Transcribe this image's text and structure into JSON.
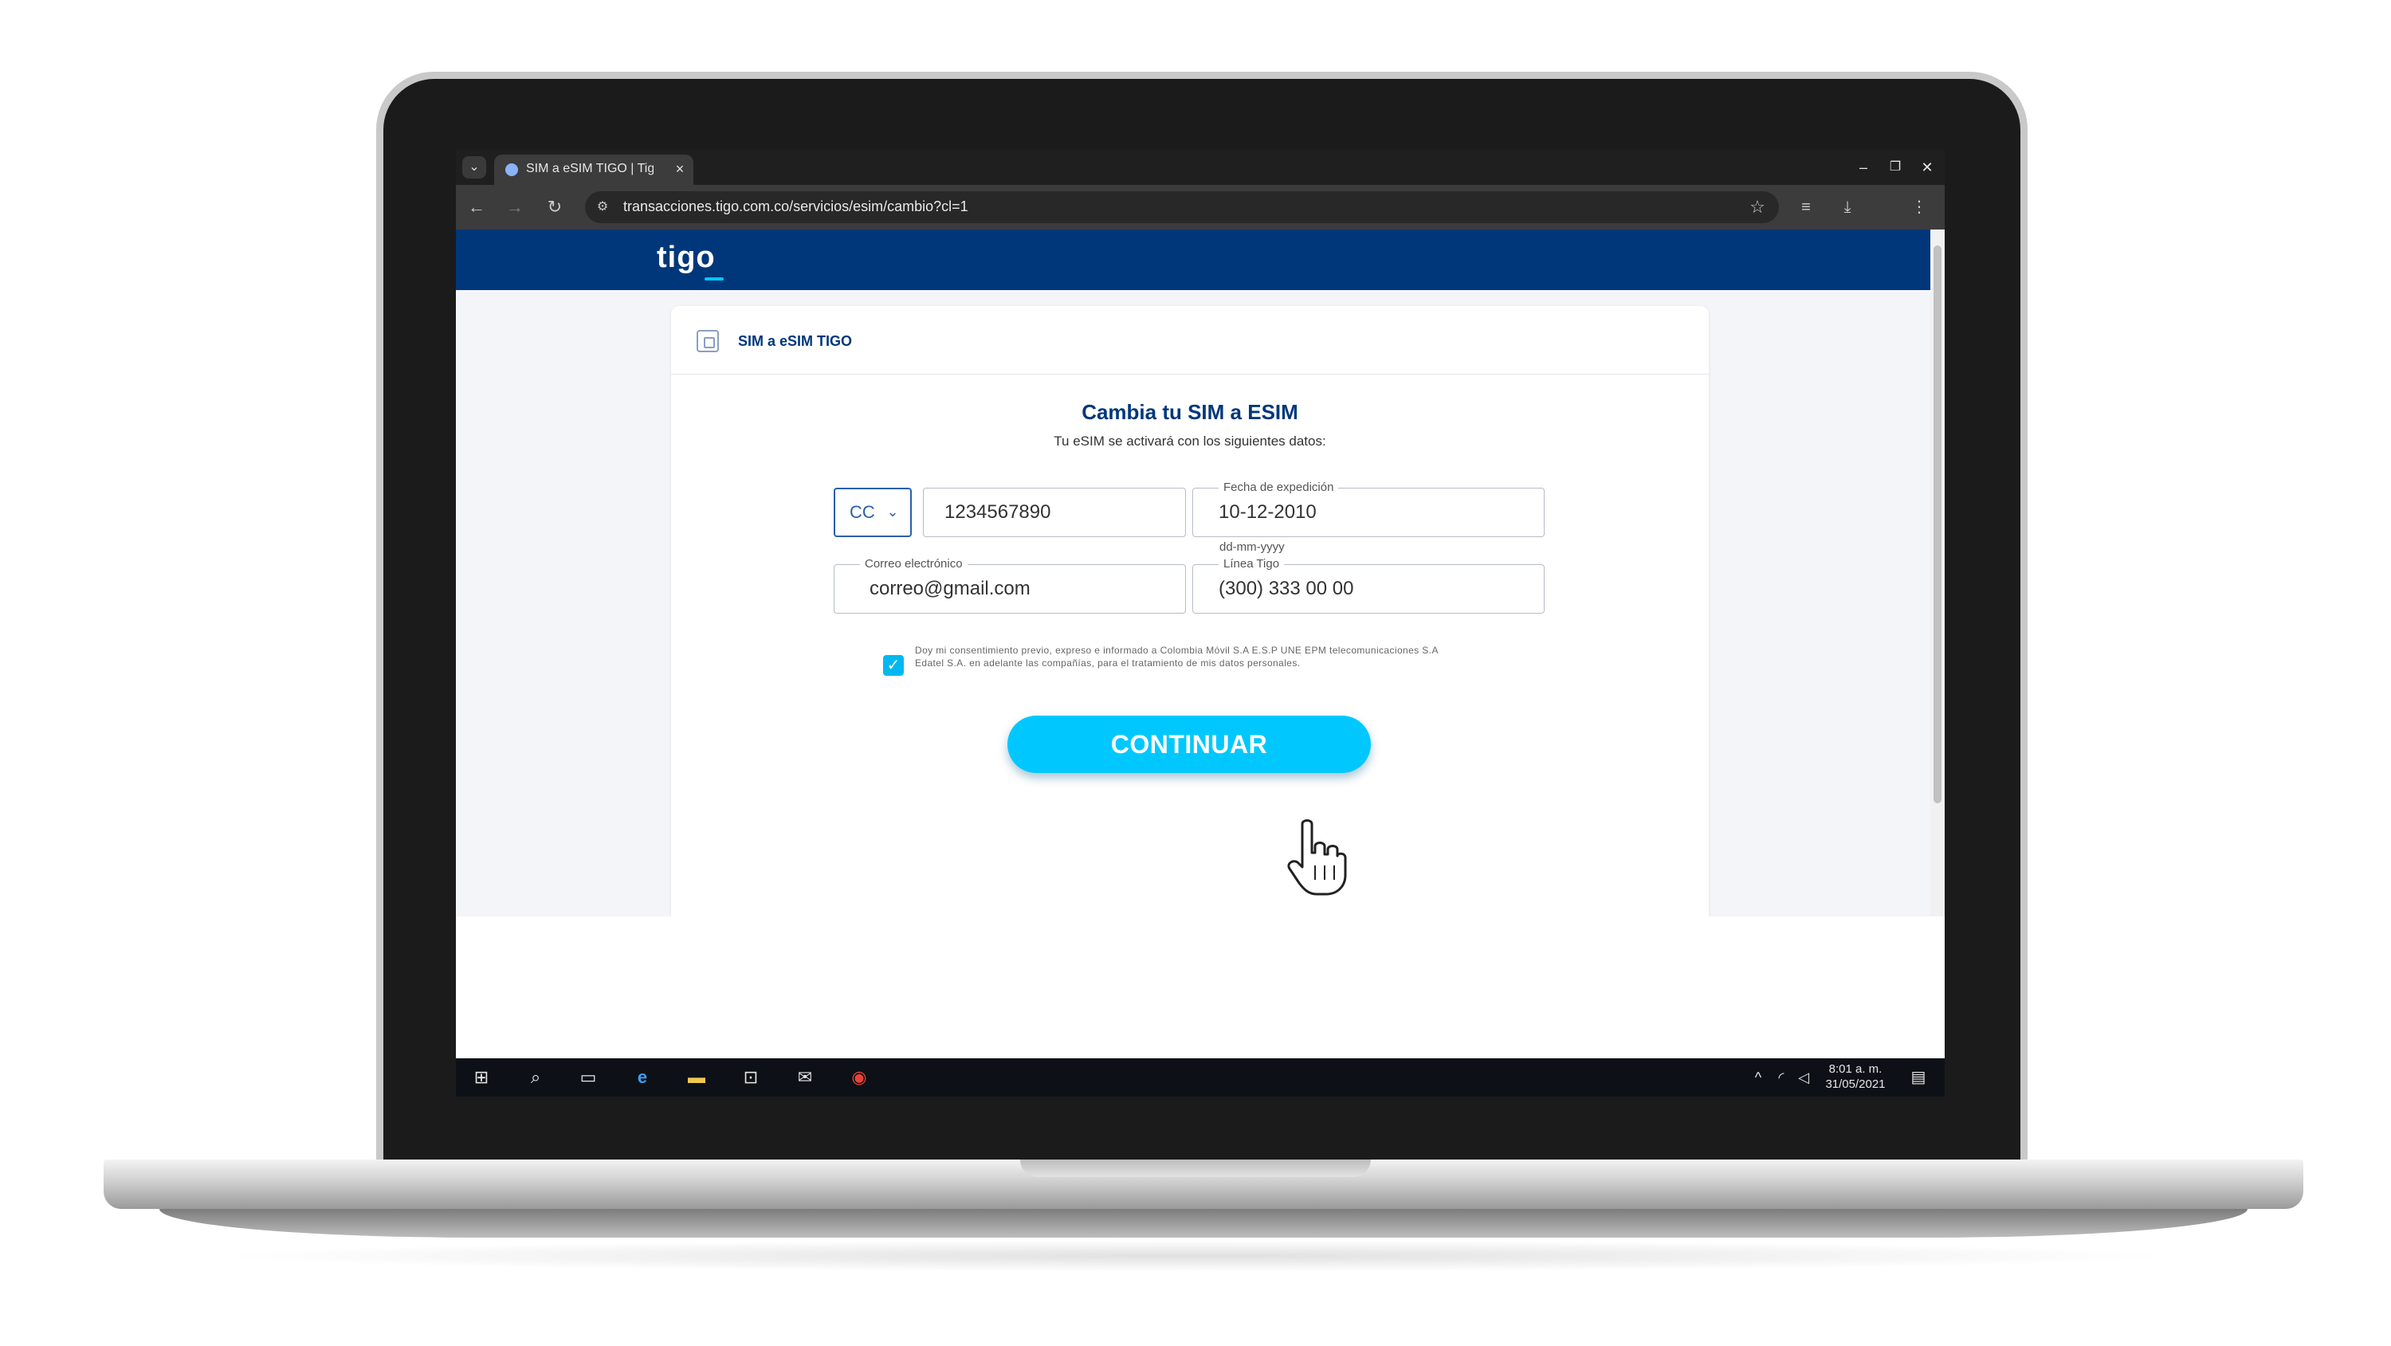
{
  "browser": {
    "tab_title": "SIM a eSIM TIGO | Tig",
    "url": "transacciones.tigo.com.co/servicios/esim/cambio?cl=1"
  },
  "page": {
    "logo": "tigo",
    "card_title": "SIM a eSIM TIGO",
    "form_title": "Cambia tu SIM a ESIM",
    "form_subtitle": "Tu eSIM se activará con los siguientes datos:",
    "doc_type": "CC",
    "doc_number": "1234567890",
    "date_label": "Fecha de expedición",
    "date_value": "10-12-2010",
    "date_hint": "dd-mm-yyyy",
    "email_label": "Correo electrónico",
    "email_value": "correo@gmail.com",
    "line_label": "Línea Tigo",
    "line_value": "(300) 333 00 00",
    "consent_text": "Doy mi consentimiento previo, expreso e informado a Colombia Móvil S.A E.S.P UNE EPM telecomunicaciones S.A Edatel S.A. en adelante las compañías, para el tratamiento de mis datos personales.",
    "consent_checked": true,
    "continue_label": "CONTINUAR"
  },
  "colors": {
    "brand_navy": "#00377b",
    "accent_cyan": "#00c8ff"
  },
  "taskbar": {
    "time": "8:01 a. m.",
    "date": "31/05/2021"
  }
}
